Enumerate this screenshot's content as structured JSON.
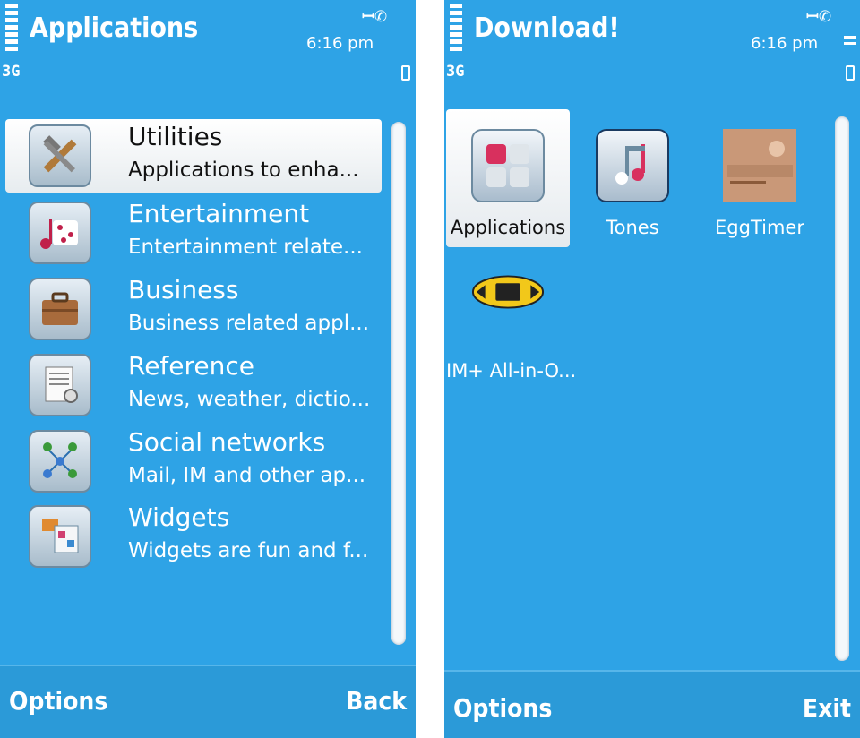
{
  "status": {
    "network": "3G",
    "time": "6:16 pm"
  },
  "applications_screen": {
    "title": "Applications",
    "items": [
      {
        "title": "Utilities",
        "subtitle": "Applications to enha...",
        "icon": "tools-icon",
        "selected": true
      },
      {
        "title": "Entertainment",
        "subtitle": "Entertainment relate...",
        "icon": "music-dice-icon",
        "selected": false
      },
      {
        "title": "Business",
        "subtitle": "Business related appl...",
        "icon": "briefcase-icon",
        "selected": false
      },
      {
        "title": "Reference",
        "subtitle": "News, weather, dictio...",
        "icon": "document-gear-icon",
        "selected": false
      },
      {
        "title": "Social networks",
        "subtitle": "Mail, IM and other ap...",
        "icon": "people-network-icon",
        "selected": false
      },
      {
        "title": "Widgets",
        "subtitle": "Widgets are fun and f...",
        "icon": "widgets-icon",
        "selected": false
      }
    ],
    "softkeys": {
      "left": "Options",
      "right": "Back"
    }
  },
  "download_screen": {
    "title": "Download!",
    "items": [
      {
        "label": "Applications",
        "icon": "applications-grid-icon",
        "selected": true
      },
      {
        "label": "Tones",
        "icon": "music-note-icon",
        "selected": false
      },
      {
        "label": "EggTimer",
        "icon": "eggtimer-logo-icon",
        "selected": false
      },
      {
        "label": "IM+ All-in-O...",
        "icon": "im-plus-logo-icon",
        "selected": false
      }
    ],
    "softkeys": {
      "left": "Options",
      "right": "Exit"
    }
  },
  "colors": {
    "background": "#2ea3e6",
    "highlight": "#ffffff",
    "text": "#ffffff"
  }
}
